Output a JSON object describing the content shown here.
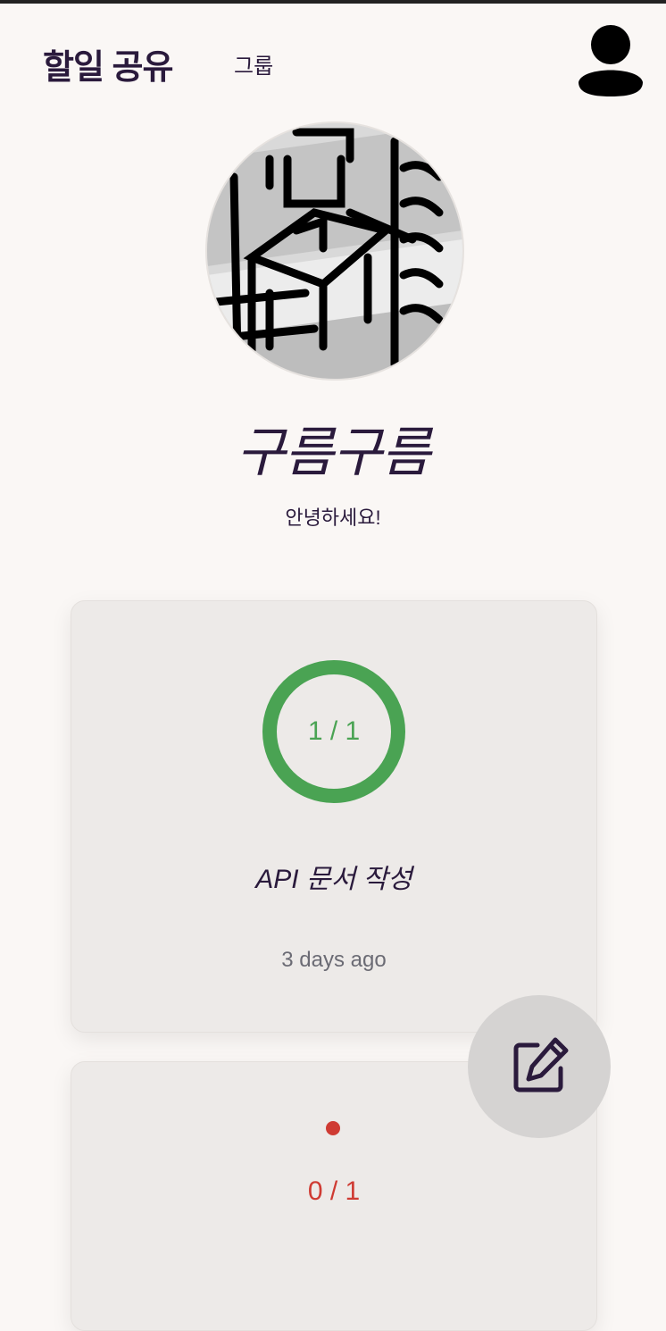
{
  "header": {
    "brand": "할일 공유",
    "nav_group": "그룹",
    "user_icon": "user-icon"
  },
  "profile": {
    "name": "구름구름",
    "bio": "안녕하세요!"
  },
  "tasks": [
    {
      "progress": "1 / 1",
      "done": 1,
      "total": 1,
      "title": "API 문서 작성",
      "time": "3 days ago",
      "status_color": "#4aa353"
    },
    {
      "progress": "0 / 1",
      "done": 0,
      "total": 1,
      "status_color": "#cf3b33"
    }
  ],
  "fab": {
    "icon": "edit-icon"
  },
  "colors": {
    "accent": "#2a1a3c",
    "background": "#faf7f5",
    "card": "#edeae8"
  }
}
